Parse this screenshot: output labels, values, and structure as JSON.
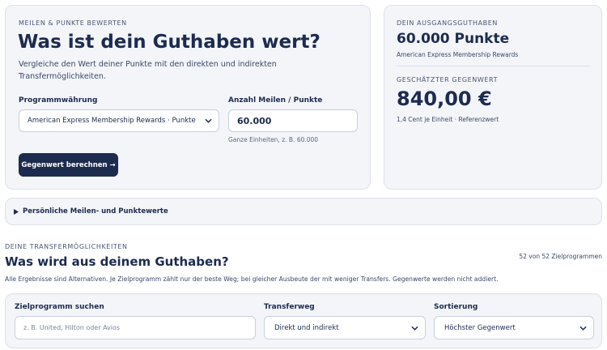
{
  "calculator": {
    "eyebrow": "MEILEN & PUNKTE BEWERTEN",
    "title": "Was ist dein Guthaben wert?",
    "description": "Vergleiche den Wert deiner Punkte mit den direkten und indirekten Transfermöglichkeiten.",
    "program_label": "Programmwährung",
    "program_value": "American Express Membership Rewards · Punkte",
    "amount_label": "Anzahl Meilen / Punkte",
    "amount_value": "60.000",
    "amount_hint": "Ganze Einheiten, z. B. 60.000",
    "calculate_button": "Gegenwert berechnen →"
  },
  "summary": {
    "balance_eyebrow": "DEIN AUSGANGSGUTHABEN",
    "balance_value": "60.000 Punkte",
    "balance_program": "American Express Membership Rewards",
    "value_eyebrow": "GESCHÄTZTER GEGENWERT",
    "value_amount": "840,00 €",
    "value_note": "1,4 Cent je Einheit · Referenzwert"
  },
  "personal_values": {
    "label": "Persönliche Meilen- und Punktewerte"
  },
  "transfers": {
    "eyebrow": "DEINE TRANSFERMÖGLICHKEITEN",
    "title": "Was wird aus deinem Guthaben?",
    "count": "52 von 52 Zielprogrammen",
    "note": "Alle Ergebnisse sind Alternativen. Je Zielprogramm zählt nur der beste Weg; bei gleicher Ausbeute der mit weniger Transfers. Gegenwerte werden nicht addiert.",
    "search_label": "Zielprogramm suchen",
    "search_placeholder": "z. B. United, Hilton oder Avios",
    "route_label": "Transferweg",
    "route_value": "Direkt und indirekt",
    "sort_label": "Sortierung",
    "sort_value": "Höchster Gegenwert"
  },
  "icons": {
    "dropdown": "chevron-down-icon",
    "disclosure": "triangle-right-icon"
  },
  "colors": {
    "navy": "#1d2b4f",
    "card_bg": "#f3f5f9",
    "button_bg": "#1d2b4f"
  }
}
